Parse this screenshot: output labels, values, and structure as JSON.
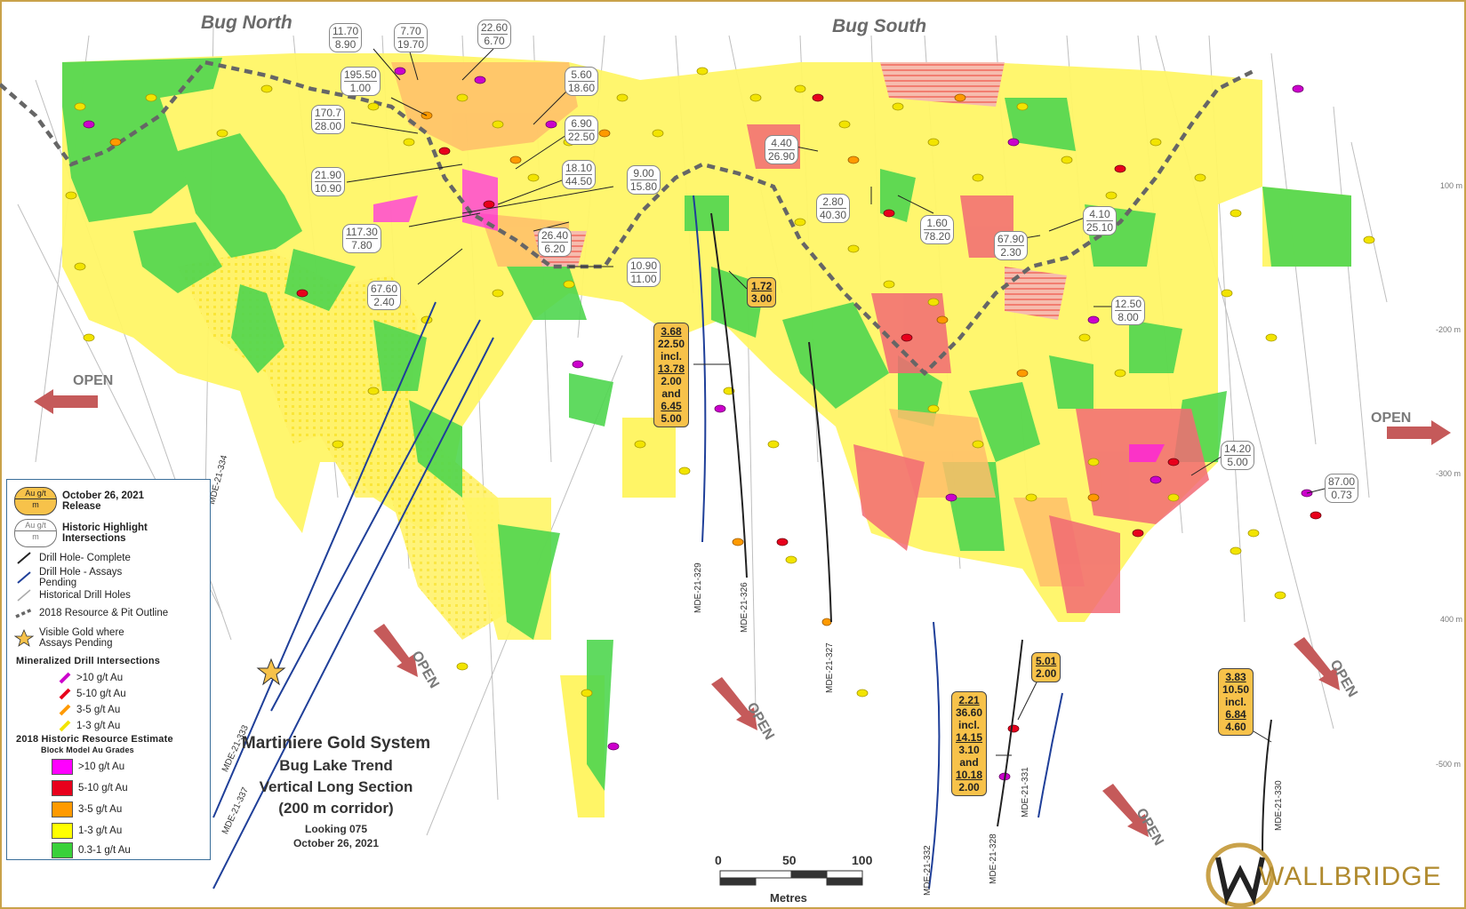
{
  "headings": {
    "north": "Bug North",
    "south": "Bug South"
  },
  "open_labels": [
    "OPEN",
    "OPEN",
    "OPEN",
    "OPEN",
    "OPEN",
    "OPEN"
  ],
  "elevations": [
    "100 m",
    "-200 m",
    "-300 m",
    "400 m",
    "-500 m"
  ],
  "historic_highlights": [
    {
      "top": "11.70",
      "bottom": "8.90"
    },
    {
      "top": "7.70",
      "bottom": "19.70"
    },
    {
      "top": "22.60",
      "bottom": "6.70"
    },
    {
      "top": "195.50",
      "bottom": "1.00"
    },
    {
      "top": "5.60",
      "bottom": "18.60"
    },
    {
      "top": "170.7",
      "bottom": "28.00"
    },
    {
      "top": "6.90",
      "bottom": "22.50"
    },
    {
      "top": "21.90",
      "bottom": "10.90"
    },
    {
      "top": "18.10",
      "bottom": "44.50"
    },
    {
      "top": "9.00",
      "bottom": "15.80"
    },
    {
      "top": "117.30",
      "bottom": "7.80"
    },
    {
      "top": "26.40",
      "bottom": "6.20"
    },
    {
      "top": "10.90",
      "bottom": "11.00"
    },
    {
      "top": "67.60",
      "bottom": "2.40"
    },
    {
      "top": "4.40",
      "bottom": "26.90"
    },
    {
      "top": "2.80",
      "bottom": "40.30"
    },
    {
      "top": "1.60",
      "bottom": "78.20"
    },
    {
      "top": "4.10",
      "bottom": "25.10"
    },
    {
      "top": "67.90",
      "bottom": "2.30"
    },
    {
      "top": "12.50",
      "bottom": "8.00"
    },
    {
      "top": "14.20",
      "bottom": "5.00"
    },
    {
      "top": "87.00",
      "bottom": "0.73"
    }
  ],
  "release_labels": {
    "r1": {
      "l1": "1.72",
      "l2": "3.00"
    },
    "r2": {
      "l1": "3.68",
      "l2": "22.50",
      "l3": "incl.",
      "l4": "13.78",
      "l5": "2.00",
      "l6": "and",
      "l7": "6.45",
      "l8": "5.00"
    },
    "r3": {
      "l1": "5.01",
      "l2": "2.00"
    },
    "r4": {
      "l1": "2.21",
      "l2": "36.60",
      "l3": "incl.",
      "l4": "14.15",
      "l5": "3.10",
      "l6": "and",
      "l7": "10.18",
      "l8": "2.00"
    },
    "r5": {
      "l1": "3.83",
      "l2": "10.50",
      "l3": "incl.",
      "l4": "6.84",
      "l5": "4.60"
    }
  },
  "drill_holes": [
    "MDE-21-334",
    "MDE-21-333",
    "MDE-21-337",
    "MDE-21-329",
    "MDE-21-326",
    "MDE-21-327",
    "MDE-21-332",
    "MDE-21-328",
    "MDE-21-331",
    "MDE-21-330"
  ],
  "legend": {
    "release_icon_top": "Au g/t",
    "release_icon_bottom": "m",
    "release_text": "October 26, 2021 Release",
    "historic_icon_top": "Au g/t",
    "historic_icon_bottom": "m",
    "historic_text": "Historic Highlight Intersections",
    "drill_complete": "Drill Hole- Complete",
    "drill_pending": "Drill Hole - Assays Pending",
    "historical_holes": "Historical Drill Holes",
    "resource_outline": "2018 Resource & Pit Outline",
    "visible_gold": "Visible Gold where Assays Pending",
    "mineralized_title": "Mineralized Drill Intersections",
    "mineralized": [
      ">10 g/t Au",
      "5-10 g/t Au",
      "3-5 g/t Au",
      "1-3 g/t Au"
    ],
    "resource_title": "2018 Historic Resource Estimate",
    "resource_subtitle": "Block Model Au Grades",
    "grades": [
      ">10 g/t Au",
      "5-10 g/t Au",
      "3-5 g/t Au",
      "1-3 g/t Au",
      "0.3-1 g/t Au"
    ]
  },
  "colors": {
    "grade_gt10": "#ff00ff",
    "grade_5_10": "#e8001c",
    "grade_3_5": "#ff9a00",
    "grade_1_3": "#ffff00",
    "grade_03_1": "#39d13a",
    "hole_complete": "#222222",
    "hole_pending": "#1f3f99",
    "historical": "#aaaaaa",
    "frame": "#c9a24a",
    "open_arrow": "#c55a5a"
  },
  "title": {
    "line1": "Martiniere Gold System",
    "line2": "Bug Lake Trend",
    "line3": "Vertical Long Section",
    "line4": "(200 m corridor)",
    "line5": "Looking 075",
    "line6": "October 26, 2021"
  },
  "scale": {
    "t0": "0",
    "t1": "50",
    "t2": "100",
    "unit": "Metres"
  },
  "logo_text": "WALLBRIDGE"
}
